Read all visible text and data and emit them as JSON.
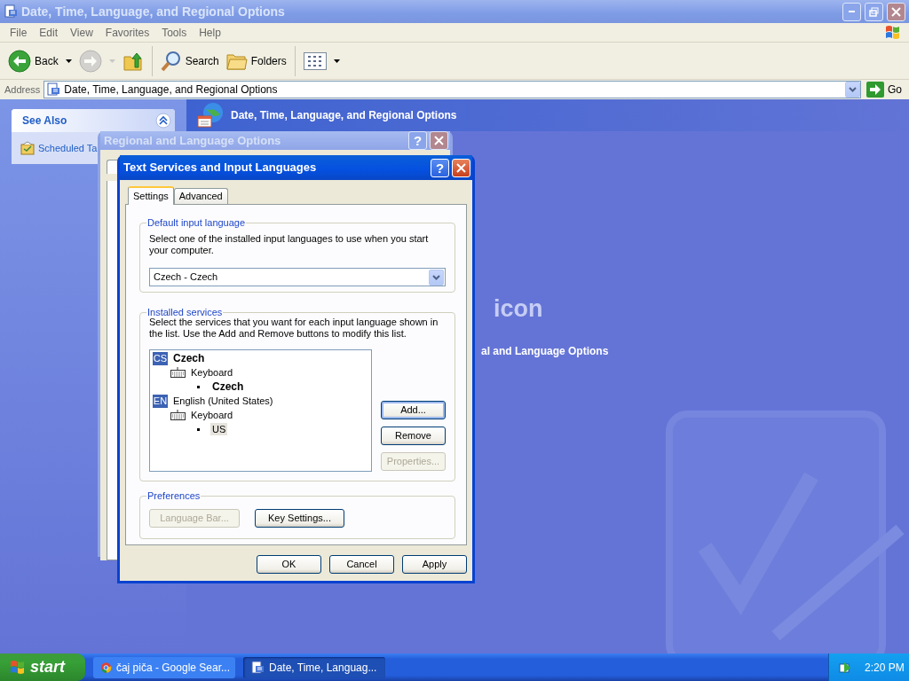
{
  "explorer": {
    "title": "Date, Time, Language, and Regional Options",
    "active": false,
    "menu": [
      "File",
      "Edit",
      "View",
      "Favorites",
      "Tools",
      "Help"
    ],
    "toolbar": [
      {
        "kind": "back",
        "label": "Back",
        "disabled": false
      },
      {
        "kind": "forward",
        "disabled": true
      },
      {
        "kind": "up",
        "disabled": false
      },
      {
        "kind": "search",
        "label": "Search",
        "disabled": false
      },
      {
        "kind": "folders",
        "label": "Folders",
        "disabled": false
      },
      {
        "kind": "views",
        "disabled": false
      }
    ],
    "address": {
      "label": "Address",
      "value": "Date, Time, Language, and Regional Options",
      "go": "Go"
    },
    "see_also": {
      "title": "See Also",
      "items": [
        "Scheduled Ta"
      ]
    },
    "header": "Date, Time, Language, and Regional Options",
    "partial_heading": "icon",
    "partial_link": "al and Language Options"
  },
  "regional_dialog": {
    "title": "Regional and Language Options",
    "active": false,
    "help": "?"
  },
  "text_services_dialog": {
    "title": "Text Services and Input Languages",
    "active": true,
    "help": "?",
    "tabs": [
      {
        "label": "Settings",
        "selected": true
      },
      {
        "label": "Advanced",
        "selected": false
      }
    ],
    "default_language": {
      "legend": "Default input language",
      "description": "Select one of the installed input languages to use when you start your computer.",
      "value": "Czech - Czech"
    },
    "services": {
      "legend": "Installed services",
      "description": "Select the services that you want for each input language shown in the list. Use the Add and Remove buttons to modify this list.",
      "tree": [
        {
          "kind": "language",
          "code": "CS",
          "label": "Czech",
          "is_default": true,
          "selected": false,
          "children": [
            {
              "kind": "category",
              "label": "Keyboard",
              "is_default": false,
              "selected": false,
              "children": [
                {
                  "kind": "layout",
                  "label": "Czech",
                  "is_default": true,
                  "selected": false
                }
              ]
            }
          ]
        },
        {
          "kind": "language",
          "code": "EN",
          "label": "English (United States)",
          "is_default": false,
          "selected": false,
          "children": [
            {
              "kind": "category",
              "label": "Keyboard",
              "is_default": false,
              "selected": false,
              "children": [
                {
                  "kind": "layout",
                  "label": "US",
                  "is_default": false,
                  "selected": true
                }
              ]
            }
          ]
        }
      ],
      "buttons": [
        {
          "label": "Add...",
          "disabled": false,
          "focused": true
        },
        {
          "label": "Remove",
          "disabled": false,
          "focused": false
        },
        {
          "label": "Properties...",
          "disabled": true,
          "focused": false
        }
      ]
    },
    "preferences": {
      "legend": "Preferences",
      "buttons": [
        {
          "label": "Language Bar...",
          "disabled": true
        },
        {
          "label": "Key Settings...",
          "disabled": false
        }
      ]
    },
    "footer_buttons": [
      {
        "label": "OK",
        "disabled": false
      },
      {
        "label": "Cancel",
        "disabled": false
      },
      {
        "label": "Apply",
        "disabled": false
      }
    ]
  },
  "taskbar": {
    "start": "start",
    "tasks": [
      {
        "kind": "browser",
        "label": "čaj piča - Google Sear...",
        "selected": false
      },
      {
        "kind": "document",
        "label": "Date, Time, Languag...",
        "selected": true
      }
    ],
    "clock": "2:20 PM"
  }
}
